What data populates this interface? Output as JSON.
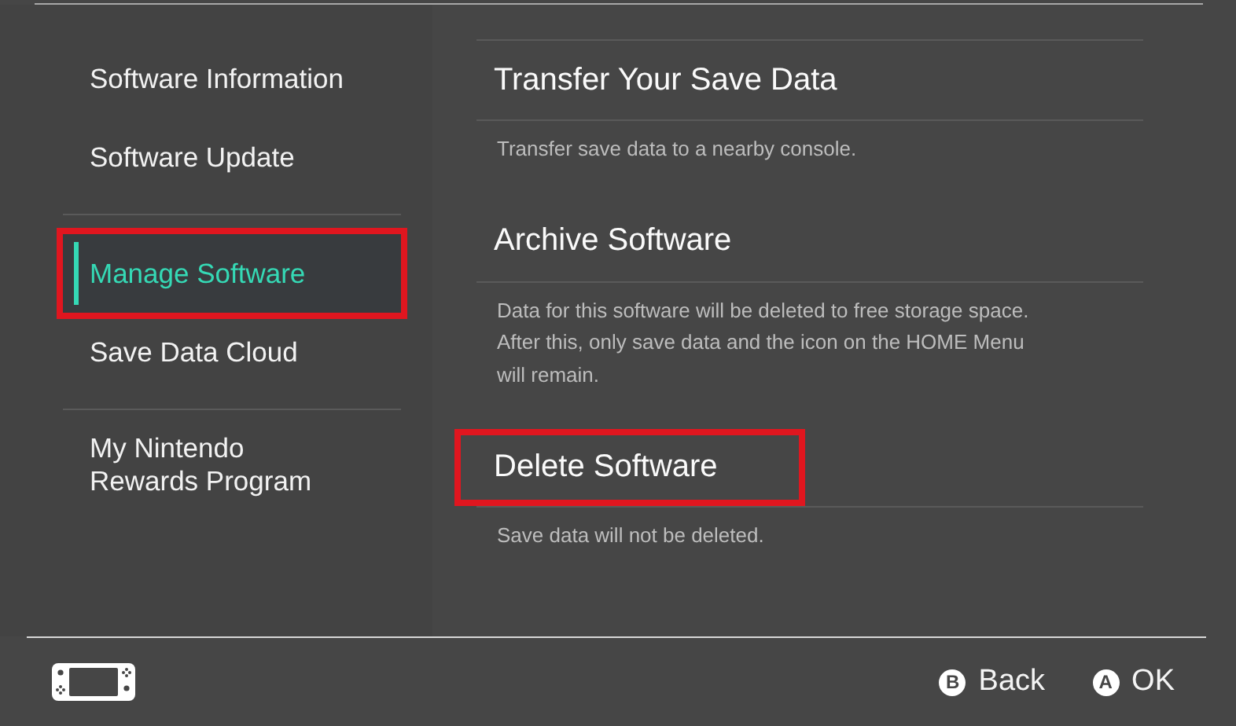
{
  "sidebar": {
    "groups": [
      {
        "items": [
          {
            "label": "Software Information",
            "selected": false,
            "highlighted": false
          },
          {
            "label": "Software Update",
            "selected": false,
            "highlighted": false
          }
        ]
      },
      {
        "items": [
          {
            "label": "Manage Software",
            "selected": true,
            "highlighted": true
          },
          {
            "label": "Save Data Cloud",
            "selected": false,
            "highlighted": false
          }
        ]
      },
      {
        "items": [
          {
            "label": "My Nintendo\nRewards Program",
            "selected": false,
            "highlighted": false
          }
        ]
      }
    ]
  },
  "options": [
    {
      "title": "Transfer Your Save Data",
      "description": "Transfer save data to a nearby console.",
      "highlighted": false
    },
    {
      "title": "Archive Software",
      "description": "Data for this software will be deleted to free storage space.\nAfter this, only save data and the icon on the HOME Menu\nwill remain.",
      "highlighted": false
    },
    {
      "title": "Delete Software",
      "description": "Save data will not be deleted.",
      "highlighted": true
    }
  ],
  "footer": {
    "hints": [
      {
        "key": "B",
        "label": "Back"
      },
      {
        "key": "A",
        "label": "OK"
      }
    ]
  }
}
